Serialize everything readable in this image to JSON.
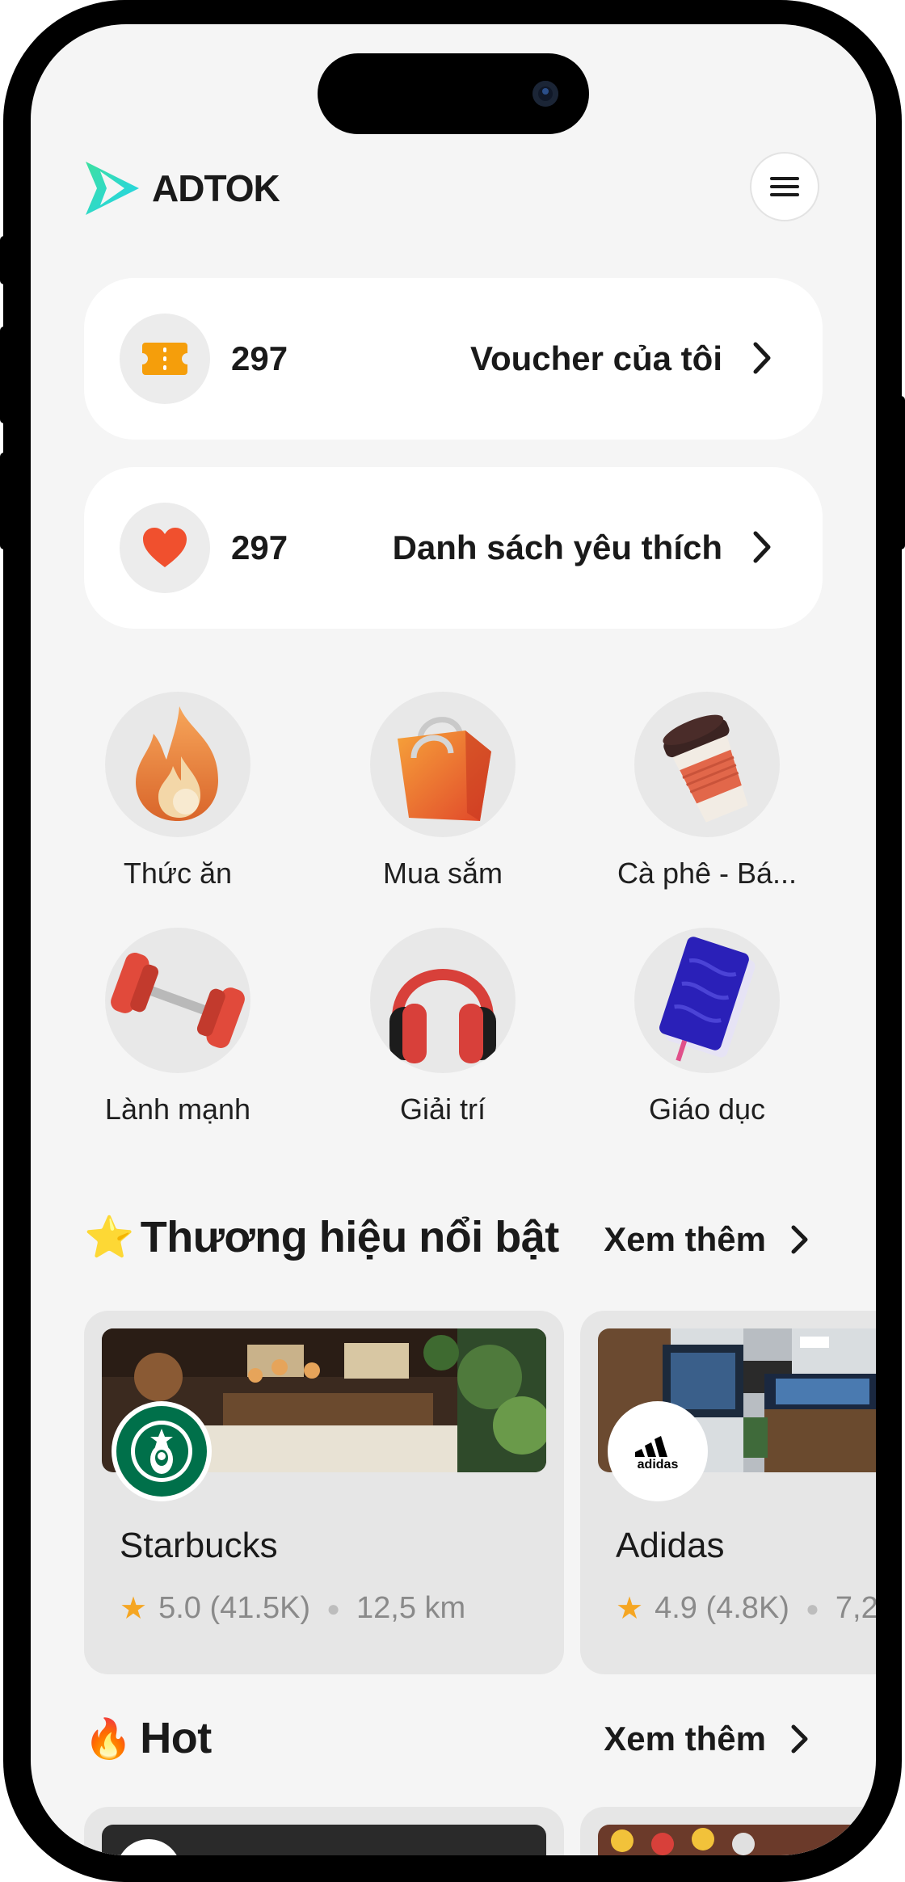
{
  "app": {
    "name": "ADTOK"
  },
  "colors": {
    "brand_gradient": [
      "#3de0a0",
      "#22d3ee"
    ],
    "voucher": "#f59e0b",
    "heart": "#f0502e",
    "star": "#f5a623",
    "card_bg": "#ffffff",
    "screen_bg": "#f5f5f5"
  },
  "voucher": {
    "count": "297",
    "label": "Voucher của tôi"
  },
  "wishlist": {
    "count": "297",
    "label": "Danh sách yêu thích"
  },
  "categories": [
    {
      "label": "Thức ăn",
      "icon": "fire-icon"
    },
    {
      "label": "Mua sắm",
      "icon": "shopping-bag-icon"
    },
    {
      "label": "Cà phê - Bá...",
      "icon": "coffee-cup-icon"
    },
    {
      "label": "Lành mạnh",
      "icon": "dumbbell-icon"
    },
    {
      "label": "Giải trí",
      "icon": "headphones-icon"
    },
    {
      "label": "Giáo dục",
      "icon": "book-icon"
    }
  ],
  "featured": {
    "emoji": "⭐",
    "title": "Thương hiệu nổi bật",
    "see_more": "Xem thêm",
    "brands": [
      {
        "name": "Starbucks",
        "rating": "5.0 (41.5K)",
        "distance": "12,5 km"
      },
      {
        "name": "Adidas",
        "rating": "4.9 (4.8K)",
        "distance": "7,2"
      }
    ]
  },
  "hot": {
    "emoji": "🔥",
    "title": "Hot",
    "see_more": "Xem thêm"
  }
}
